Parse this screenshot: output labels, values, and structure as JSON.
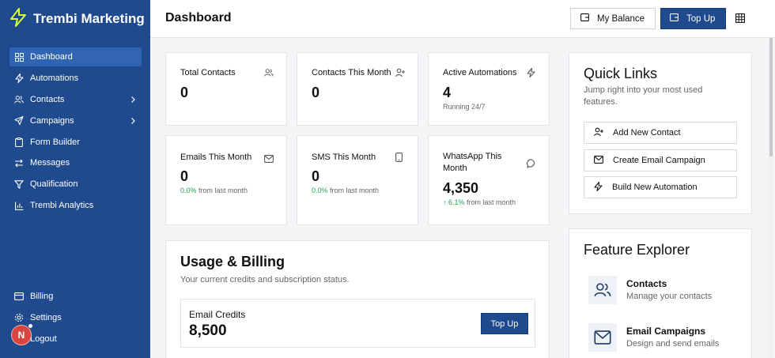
{
  "brand": {
    "name": "Trembi Marketing"
  },
  "sidebar": {
    "items": [
      {
        "label": "Dashboard",
        "icon": "dashboard-icon"
      },
      {
        "label": "Automations",
        "icon": "bolt-icon"
      },
      {
        "label": "Contacts",
        "icon": "users-icon"
      },
      {
        "label": "Campaigns",
        "icon": "send-icon"
      },
      {
        "label": "Form Builder",
        "icon": "clipboard-icon"
      },
      {
        "label": "Messages",
        "icon": "arrows-icon"
      },
      {
        "label": "Qualification",
        "icon": "filter-icon"
      },
      {
        "label": "Trembi Analytics",
        "icon": "bar-chart-icon"
      }
    ],
    "bottom": [
      {
        "label": "Billing",
        "icon": "card-icon"
      },
      {
        "label": "Settings",
        "icon": "gear-icon"
      },
      {
        "label": "Logout",
        "icon": "logout-icon"
      }
    ],
    "avatar_initial": "N"
  },
  "header": {
    "title": "Dashboard",
    "balance_label": "My Balance",
    "topup_label": "Top Up"
  },
  "stats": {
    "total_contacts": {
      "title": "Total Contacts",
      "value": "0"
    },
    "contacts_month": {
      "title": "Contacts This Month",
      "value": "0"
    },
    "active_automations": {
      "title": "Active Automations",
      "value": "4",
      "sub": "Running 24/7"
    },
    "emails_month": {
      "title": "Emails This Month",
      "value": "0",
      "change": "0.0%",
      "change_text": "from last month"
    },
    "sms_month": {
      "title": "SMS This Month",
      "value": "0",
      "change": "0.0%",
      "change_text": "from last month"
    },
    "whatsapp_month": {
      "title_line1": "WhatsApp This",
      "title_line2": "Month",
      "value": "4,350",
      "change": "6.1%",
      "change_text": "from last month"
    }
  },
  "quick_links": {
    "title": "Quick Links",
    "subtitle_line1": "Jump right into your most used",
    "subtitle_line2": "features.",
    "items": [
      {
        "label": "Add New Contact",
        "icon": "user-plus-icon"
      },
      {
        "label": "Create Email Campaign",
        "icon": "mail-icon"
      },
      {
        "label": "Build New Automation",
        "icon": "bolt-icon"
      }
    ]
  },
  "usage": {
    "title": "Usage & Billing",
    "subtitle": "Your current credits and subscription status.",
    "credits_title": "Email Credits",
    "credits_value": "8,500",
    "topup_label": "Top Up"
  },
  "feature_explorer": {
    "title": "Feature Explorer",
    "items": [
      {
        "title": "Contacts",
        "sub": "Manage your contacts",
        "icon": "users-icon"
      },
      {
        "title": "Email Campaigns",
        "sub": "Design and send emails",
        "icon": "mail-icon"
      }
    ]
  },
  "colors": {
    "primary": "#1f4a8e",
    "accent": "#d9ff3b",
    "success": "#22a35a"
  }
}
